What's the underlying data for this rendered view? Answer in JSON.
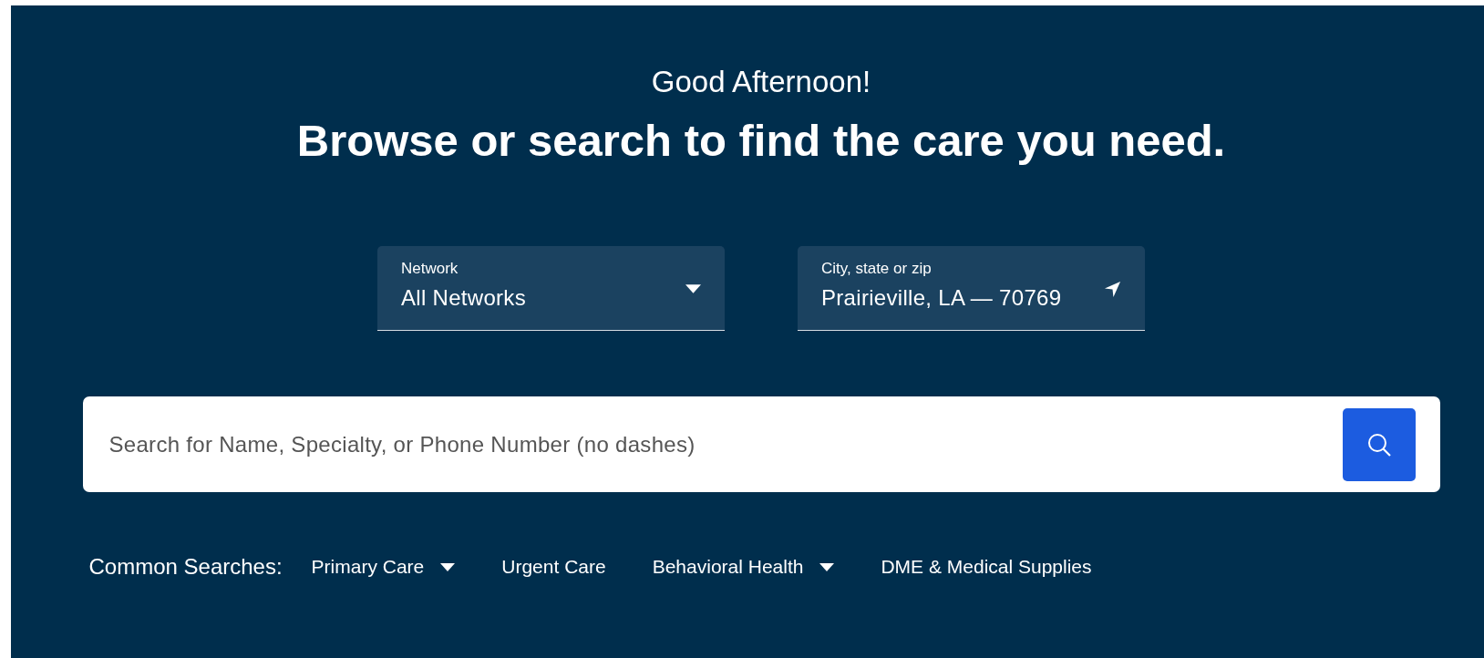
{
  "greeting": "Good Afternoon!",
  "headline": "Browse or search to find the care you need.",
  "filters": [
    {
      "kind": "dropdown",
      "label": "Network",
      "value": "All Networks"
    },
    {
      "kind": "location",
      "label": "City, state or zip",
      "value": "Prairieville, LA — 70769"
    }
  ],
  "search": {
    "placeholder": "Search for Name, Specialty, or Phone Number (no dashes)"
  },
  "common_searches": {
    "label": "Common Searches:",
    "items": [
      {
        "label": "Primary Care",
        "has_menu": true
      },
      {
        "label": "Urgent Care",
        "has_menu": false
      },
      {
        "label": "Behavioral Health",
        "has_menu": true
      },
      {
        "label": "DME & Medical Supplies",
        "has_menu": false
      }
    ]
  }
}
